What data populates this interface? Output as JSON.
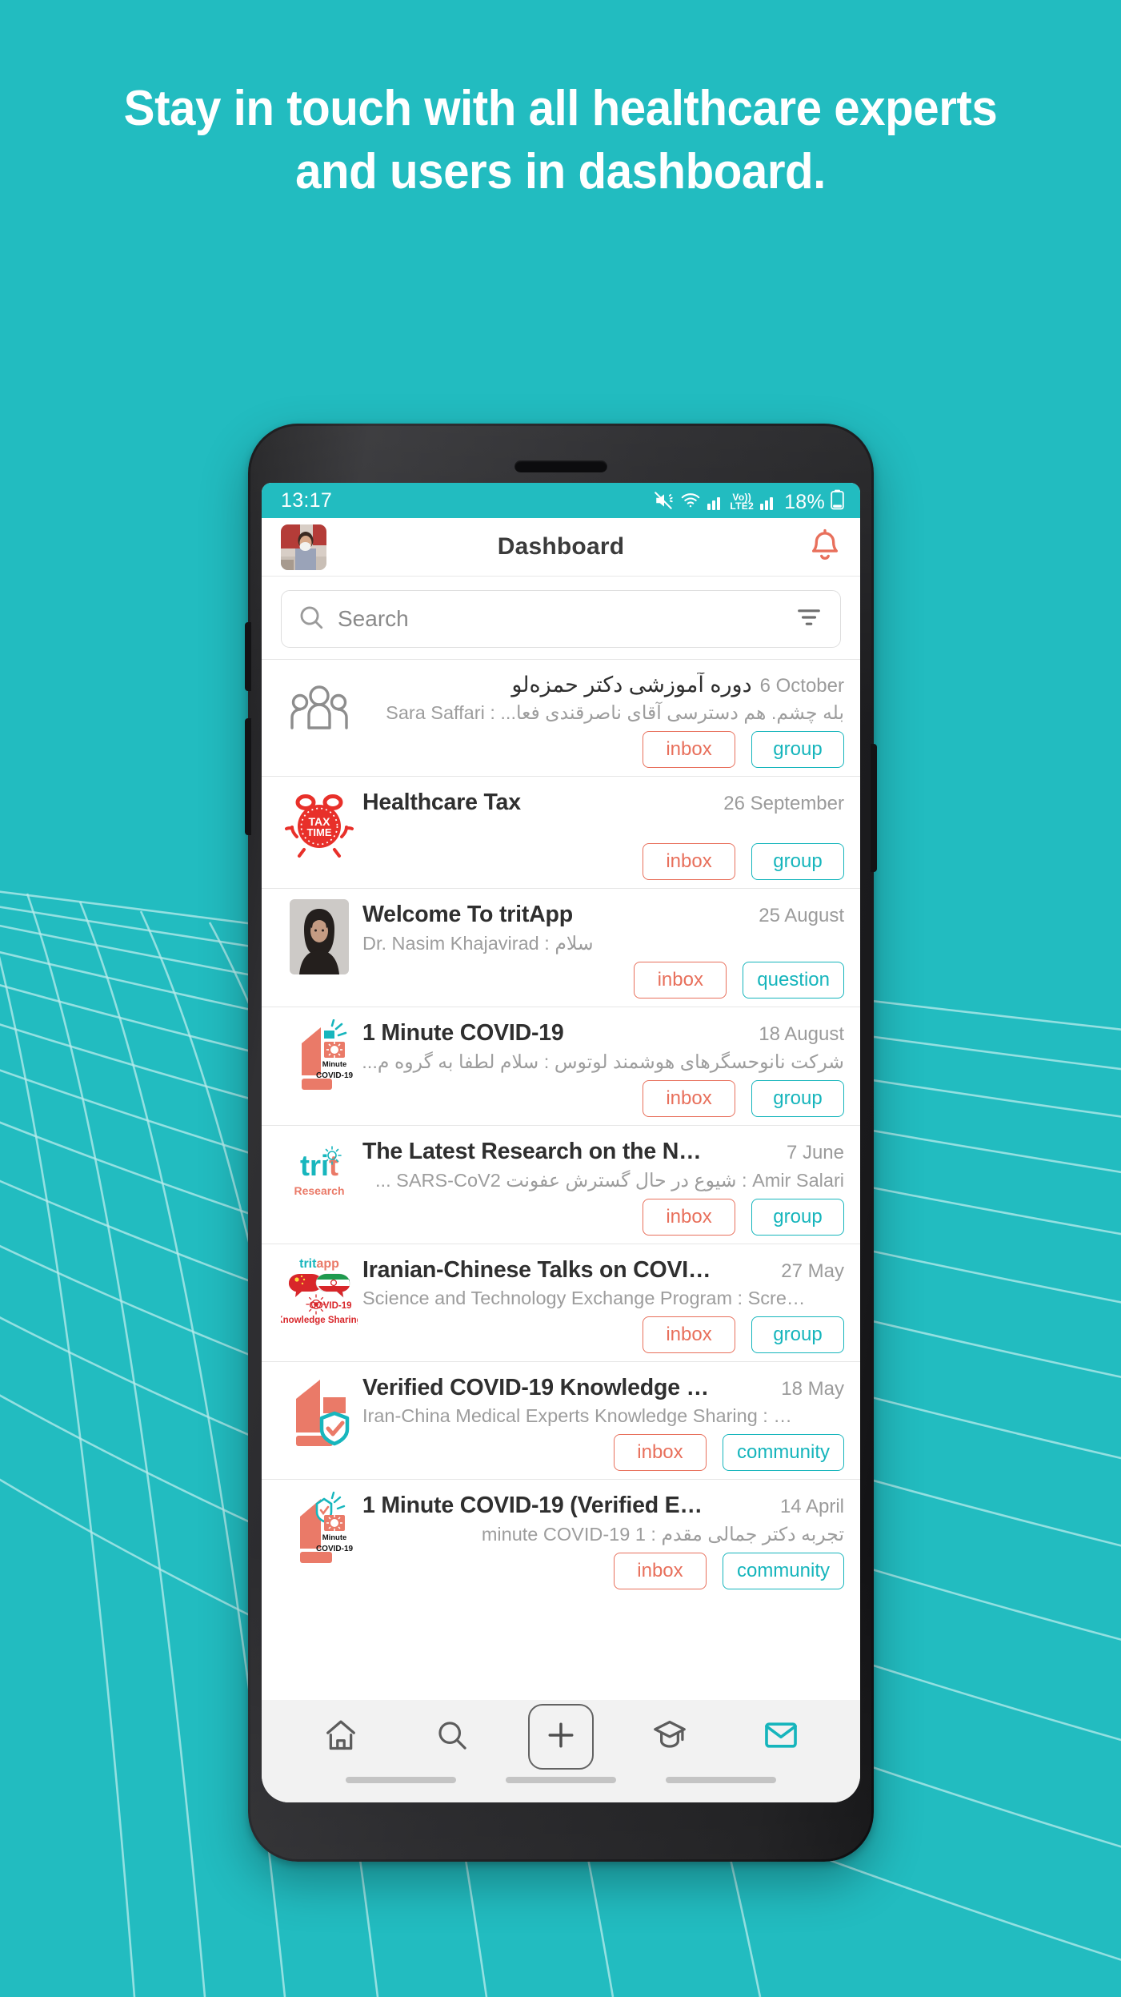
{
  "colors": {
    "background_teal": "#22bcc0",
    "accent_coral": "#e8705c",
    "accent_teal": "#16b5bc",
    "headline_text": "#ffffff"
  },
  "headline": {
    "line1": "Stay in touch with all healthcare experts",
    "line2": "and users in dashboard."
  },
  "phone": {
    "statusbar": {
      "time": "13:17",
      "icons": [
        "mute-icon",
        "wifi-icon",
        "signal-bars-icon",
        "volte2-icon",
        "signal-bars-2-icon"
      ],
      "network_label": "VoLTE2",
      "battery": "18%"
    },
    "appbar": {
      "avatar_name": "user-avatar",
      "title": "Dashboard",
      "bell_icon": "notification-bell-icon"
    },
    "search": {
      "placeholder": "Search",
      "search_icon": "search-icon",
      "filter_icon": "filter-icon"
    },
    "list": [
      {
        "icon": "group-people-icon",
        "title": "دوره آموزشی دکتر حمزه‌لو",
        "title_rtl": true,
        "date": "6 October",
        "subtitle": "بله چشم. هم دسترسی آقای ناصرقندی فعا... : Sara Saffari",
        "subtitle_rtl": true,
        "tags": [
          {
            "label": "inbox",
            "style": "inbox"
          },
          {
            "label": "group",
            "style": "teal"
          }
        ]
      },
      {
        "icon": "tax-time-alarm-icon",
        "title": "Healthcare Tax",
        "title_rtl": false,
        "date": "26 September",
        "subtitle": "",
        "subtitle_rtl": false,
        "tags": [
          {
            "label": "inbox",
            "style": "inbox"
          },
          {
            "label": "group",
            "style": "teal"
          }
        ]
      },
      {
        "icon": "woman-avatar-icon",
        "title": "Welcome To tritApp",
        "title_rtl": false,
        "date": "25 August",
        "subtitle": "Dr. Nasim Khajavirad  :  سلام",
        "subtitle_rtl": false,
        "tags": [
          {
            "label": "inbox",
            "style": "inbox"
          },
          {
            "label": "question",
            "style": "teal"
          }
        ]
      },
      {
        "icon": "one-minute-covid-icon",
        "title": "1 Minute COVID-19",
        "title_rtl": false,
        "date": "18 August",
        "subtitle": "شرکت نانوحسگرهای هوشمند لوتوس  :  سلام لطفا به گروه م...",
        "subtitle_rtl": true,
        "tags": [
          {
            "label": "inbox",
            "style": "inbox"
          },
          {
            "label": "group",
            "style": "teal"
          }
        ]
      },
      {
        "icon": "trit-research-icon",
        "title": "The Latest Research on the N…",
        "title_rtl": false,
        "date": "7 June",
        "subtitle": "Amir Salari  :  شیوع در حال گسترش عفونت SARS-CoV2 ...",
        "subtitle_rtl": true,
        "tags": [
          {
            "label": "inbox",
            "style": "inbox"
          },
          {
            "label": "group",
            "style": "teal"
          }
        ]
      },
      {
        "icon": "iran-china-knowledge-sharing-icon",
        "title": "Iranian-Chinese Talks on COVI…",
        "title_rtl": false,
        "date": "27 May",
        "subtitle": "Science and Technology Exchange Program : Scre…",
        "subtitle_rtl": false,
        "tags": [
          {
            "label": "inbox",
            "style": "inbox"
          },
          {
            "label": "group",
            "style": "teal"
          }
        ]
      },
      {
        "icon": "verified-covid-knowledge-icon",
        "title": "Verified COVID-19 Knowledge …",
        "title_rtl": false,
        "date": "18 May",
        "subtitle": "Iran-China Medical Experts Knowledge Sharing : …",
        "subtitle_rtl": false,
        "tags": [
          {
            "label": "inbox",
            "style": "inbox"
          },
          {
            "label": "community",
            "style": "teal"
          }
        ]
      },
      {
        "icon": "one-minute-covid-verified-icon",
        "title": "1 Minute COVID-19 (Verified E…",
        "title_rtl": false,
        "date": "14 April",
        "subtitle": "تجربه دکتر جمالی مقدم : 1 minute COVID-19",
        "subtitle_rtl": true,
        "tags": [
          {
            "label": "inbox",
            "style": "inbox"
          },
          {
            "label": "community",
            "style": "teal"
          }
        ]
      }
    ],
    "bottomnav": [
      {
        "icon": "home-icon",
        "active": false
      },
      {
        "icon": "search-icon",
        "active": false
      },
      {
        "icon": "plus-add-icon",
        "active": false
      },
      {
        "icon": "graduation-cap-icon",
        "active": false
      },
      {
        "icon": "mail-envelope-icon",
        "active": true
      }
    ]
  }
}
